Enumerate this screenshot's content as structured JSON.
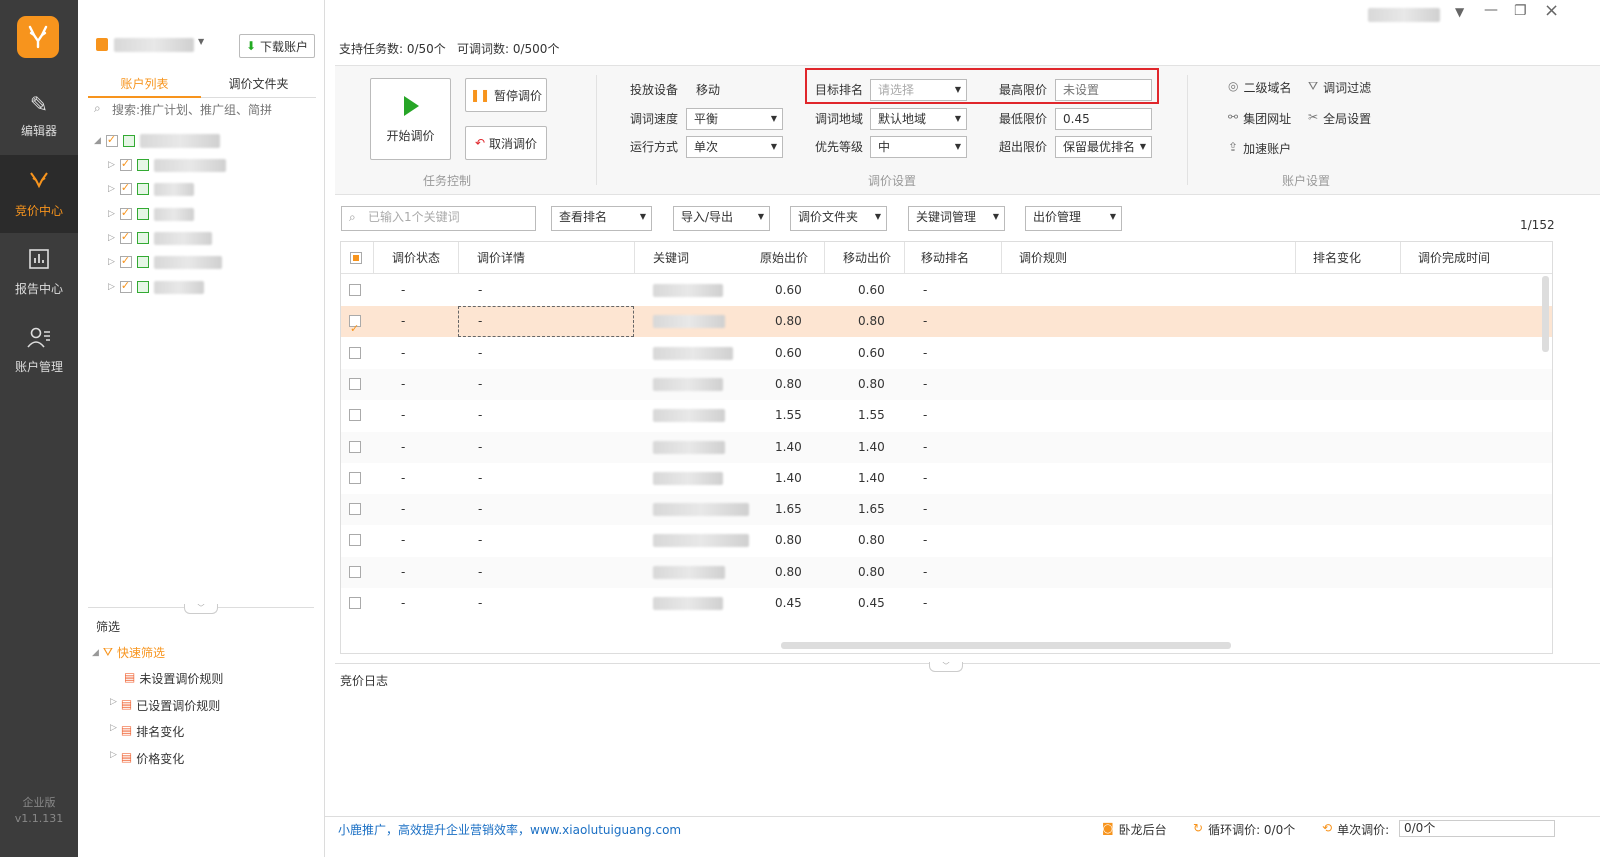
{
  "nav": {
    "items": [
      {
        "label": "编辑器",
        "icon": "edit-icon"
      },
      {
        "label": "竞价中心",
        "icon": "deer-icon"
      },
      {
        "label": "报告中心",
        "icon": "report-icon"
      },
      {
        "label": "账户管理",
        "icon": "user-manage-icon"
      }
    ],
    "edition": "企业版",
    "version": "v1.1.131"
  },
  "account": {
    "download": "下载账户",
    "tabs": [
      "账户列表",
      "调价文件夹"
    ],
    "search_placeholder": "搜索:推广计划、推广组、简拼"
  },
  "filter": {
    "title": "筛选",
    "quick": "快速筛选",
    "items": [
      "未设置调价规则",
      "已设置调价规则",
      "排名变化",
      "价格变化"
    ]
  },
  "top": {
    "tasks": "支持任务数: 0/50个",
    "kw_count": "可调词数: 0/500个"
  },
  "task": {
    "start": "开始调价",
    "pause": "暂停调价",
    "cancel": "取消调价",
    "section": "任务控制"
  },
  "settings": {
    "device_label": "投放设备",
    "device_value": "移动",
    "speed_label": "调词速度",
    "speed_value": "平衡",
    "mode_label": "运行方式",
    "mode_value": "单次",
    "rank_label": "目标排名",
    "rank_placeholder": "请选择",
    "region_label": "调词地域",
    "region_value": "默认地域",
    "priority_label": "优先等级",
    "priority_value": "中",
    "max_label": "最高限价",
    "max_placeholder": "未设置",
    "min_label": "最低限价",
    "min_value": "0.45",
    "over_label": "超出限价",
    "over_value": "保留最优排名",
    "section": "调价设置"
  },
  "acct_settings": {
    "items": [
      "二级域名",
      "调词过滤",
      "集团网址",
      "全局设置",
      "加速账户"
    ],
    "section": "账户设置"
  },
  "toolbar": {
    "kw_placeholder": "已输入1个关键词",
    "view_rank": "查看排名",
    "import_export": "导入/导出",
    "folder": "调价文件夹",
    "kw_manage": "关键词管理",
    "bid_manage": "出价管理",
    "page": "1/152"
  },
  "columns": [
    "调价状态",
    "调价详情",
    "关键词",
    "原始出价",
    "移动出价",
    "移动排名",
    "调价规则",
    "排名变化",
    "调价完成时间"
  ],
  "rows": [
    {
      "status": "-",
      "detail": "-",
      "orig": "0.60",
      "mobile": "0.60",
      "rank": "-",
      "checked": false
    },
    {
      "status": "-",
      "detail": "-",
      "orig": "0.80",
      "mobile": "0.80",
      "rank": "-",
      "checked": true
    },
    {
      "status": "-",
      "detail": "-",
      "orig": "0.60",
      "mobile": "0.60",
      "rank": "-",
      "checked": false
    },
    {
      "status": "-",
      "detail": "-",
      "orig": "0.80",
      "mobile": "0.80",
      "rank": "-",
      "checked": false
    },
    {
      "status": "-",
      "detail": "-",
      "orig": "1.55",
      "mobile": "1.55",
      "rank": "-",
      "checked": false
    },
    {
      "status": "-",
      "detail": "-",
      "orig": "1.40",
      "mobile": "1.40",
      "rank": "-",
      "checked": false
    },
    {
      "status": "-",
      "detail": "-",
      "orig": "1.40",
      "mobile": "1.40",
      "rank": "-",
      "checked": false
    },
    {
      "status": "-",
      "detail": "-",
      "orig": "1.65",
      "mobile": "1.65",
      "rank": "-",
      "checked": false
    },
    {
      "status": "-",
      "detail": "-",
      "orig": "0.80",
      "mobile": "0.80",
      "rank": "-",
      "checked": false
    },
    {
      "status": "-",
      "detail": "-",
      "orig": "0.80",
      "mobile": "0.80",
      "rank": "-",
      "checked": false
    },
    {
      "status": "-",
      "detail": "-",
      "orig": "0.45",
      "mobile": "0.45",
      "rank": "-",
      "checked": false
    }
  ],
  "log": {
    "title": "竞价日志"
  },
  "status": {
    "slogan": "小鹿推广，高效提升企业营销效率，www.xiaolutuiguang.com",
    "backend": "卧龙后台",
    "cycle": "循环调价: 0/0个",
    "single": "单次调价:",
    "single_value": "0/0个"
  },
  "colors": {
    "accent": "#f7941d",
    "nav_bg": "#3c3c3c",
    "highlight_row": "#fde5d2",
    "red_box": "#e0262b",
    "link": "#1a6fc4"
  }
}
